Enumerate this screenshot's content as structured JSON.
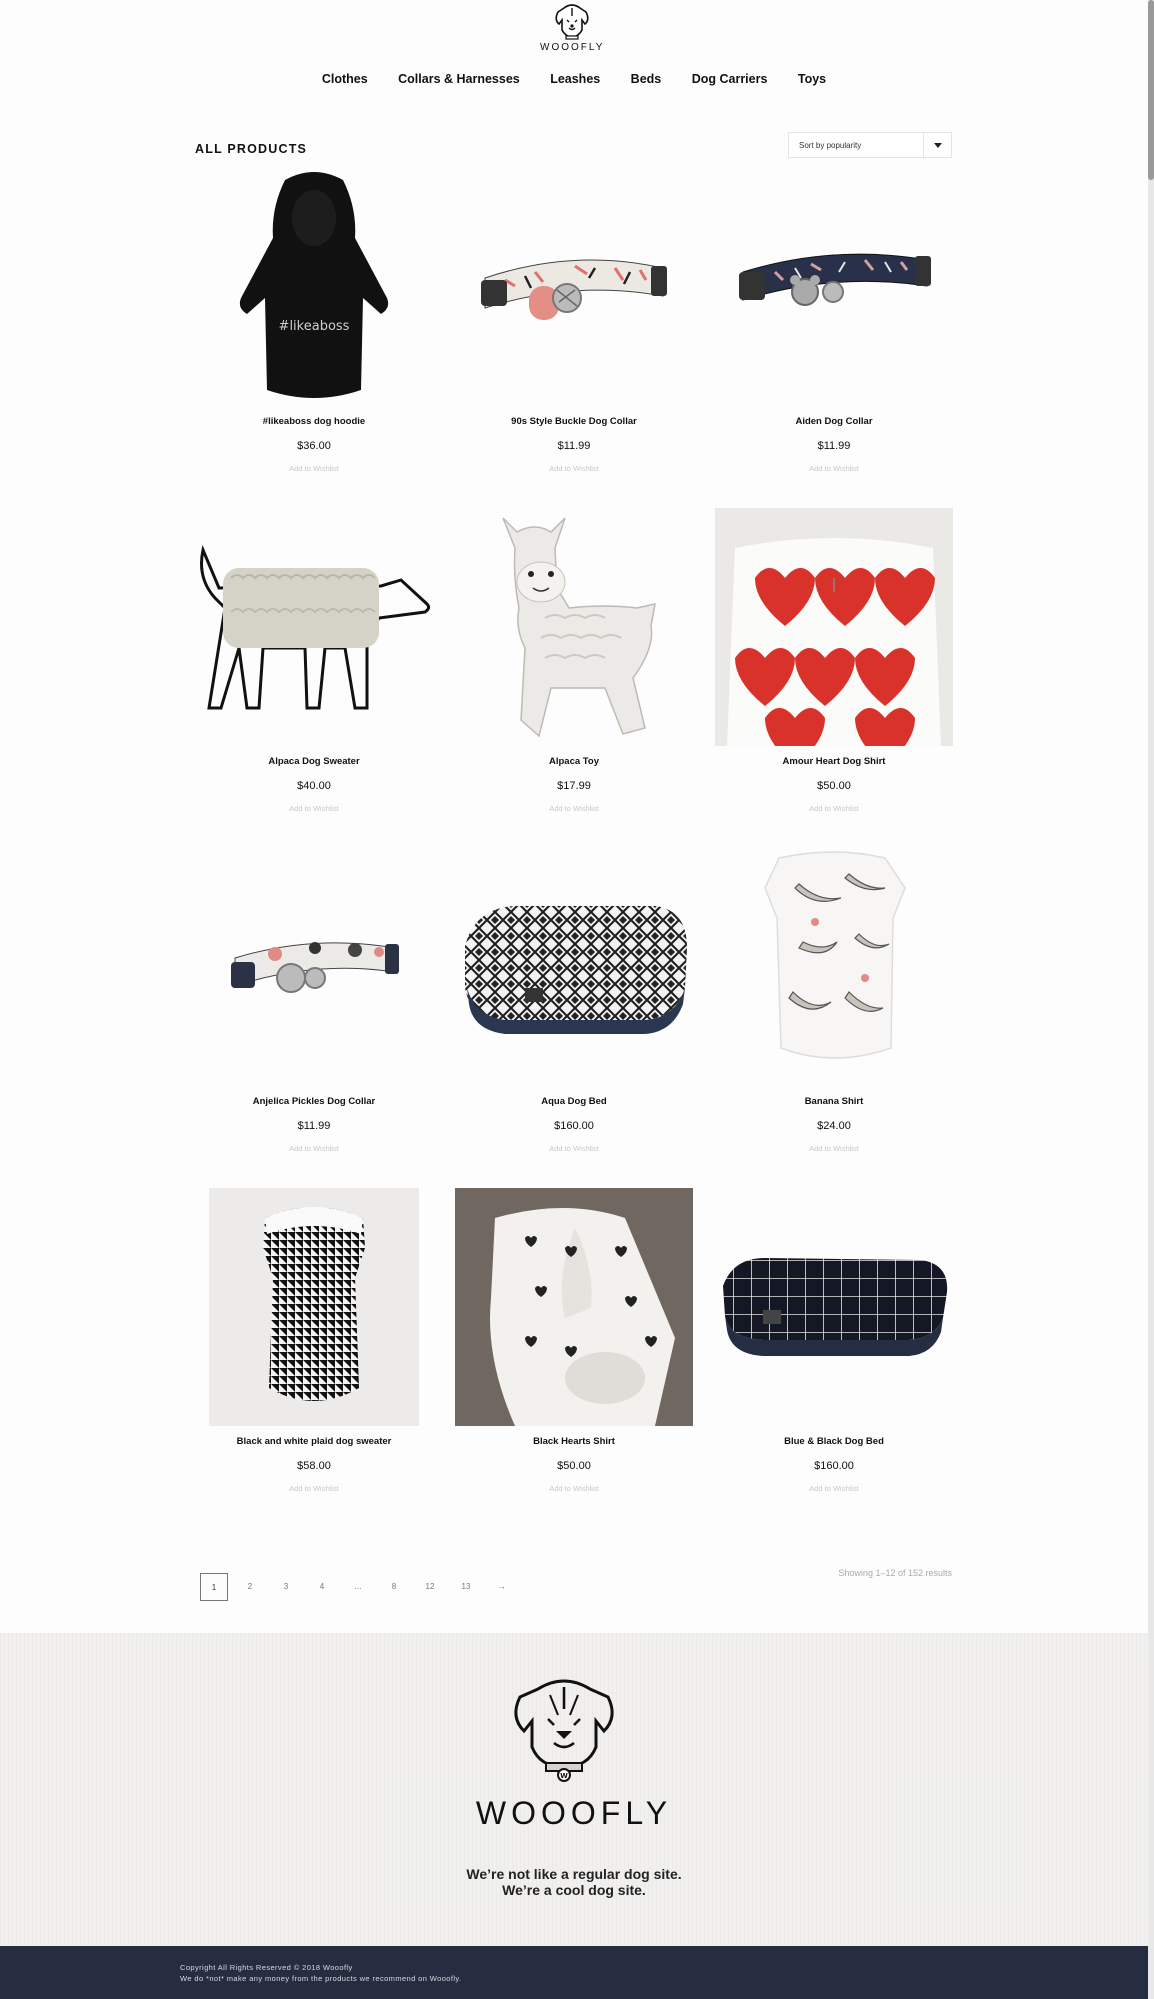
{
  "brand": {
    "name": "WOOOFLY"
  },
  "nav": [
    "Clothes",
    "Collars & Harnesses",
    "Leashes",
    "Beds",
    "Dog Carriers",
    "Toys"
  ],
  "catalog": {
    "title": "ALL PRODUCTS",
    "sort_selected": "Sort by popularity",
    "wishlist_label": "Add to Wishlist",
    "products": [
      {
        "name": "#likeaboss dog hoodie",
        "price": "$36.00",
        "print": "#likeaboss"
      },
      {
        "name": "90s Style Buckle Dog Collar",
        "price": "$11.99"
      },
      {
        "name": "Aiden Dog Collar",
        "price": "$11.99"
      },
      {
        "name": "Alpaca Dog Sweater",
        "price": "$40.00"
      },
      {
        "name": "Alpaca Toy",
        "price": "$17.99"
      },
      {
        "name": "Amour Heart Dog Shirt",
        "price": "$50.00"
      },
      {
        "name": "Anjelica Pickles Dog Collar",
        "price": "$11.99"
      },
      {
        "name": "Aqua Dog Bed",
        "price": "$160.00"
      },
      {
        "name": "Banana Shirt",
        "price": "$24.00"
      },
      {
        "name": "Black and white plaid dog sweater",
        "price": "$58.00"
      },
      {
        "name": "Black Hearts Shirt",
        "price": "$50.00"
      },
      {
        "name": "Blue & Black Dog Bed",
        "price": "$160.00"
      }
    ]
  },
  "pagination": {
    "pages": [
      "1",
      "2",
      "3",
      "4",
      "…",
      "8",
      "12",
      "13",
      "→"
    ],
    "current": "1",
    "results": "Showing 1–12 of 152 results"
  },
  "footer": {
    "brand": "WOOOFLY",
    "tagline_1": "We’re not like a regular dog site.",
    "tagline_2": "We’re a cool dog site.",
    "copyright": "Copyright All Rights Reserved © 2018 Wooofly",
    "disclaimer": "We do *not* make any money from the products we recommend on Wooofly."
  },
  "colors": {
    "footer_bar": "#272d40",
    "heart_red": "#d8322a",
    "text": "#111111"
  }
}
